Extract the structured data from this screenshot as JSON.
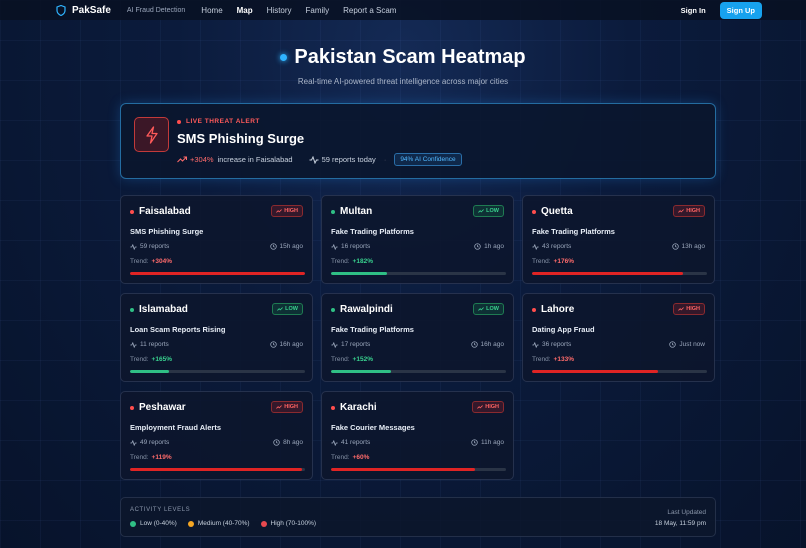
{
  "colors": {
    "high": "#e02424",
    "low": "#2fbf85",
    "medium": "#f5a623",
    "accent": "#17a2ee"
  },
  "nav": {
    "brand": "PakSafe",
    "tagline": "AI Fraud Detection",
    "links": [
      "Home",
      "Map",
      "History",
      "Family",
      "Report a Scam"
    ],
    "active": "Map",
    "sign_in": "Sign In",
    "sign_up": "Sign Up"
  },
  "hero": {
    "title": "Pakistan Scam Heatmap",
    "subtitle": "Real-time AI-powered threat intelligence across major cities"
  },
  "alert": {
    "tag": "LIVE THREAT ALERT",
    "title": "SMS Phishing Surge",
    "increase": "+304%",
    "increase_text": "increase in Faisalabad",
    "reports": "59 reports today",
    "confidence": "94% AI Confidence",
    "icon": "lightning-icon"
  },
  "cards": [
    {
      "city": "Faisalabad",
      "level": "HIGH",
      "type": "SMS Phishing Surge",
      "reports": "59 reports",
      "time": "15h ago",
      "trend_label": "Trend:",
      "trend": "+304%",
      "progress": 1.0
    },
    {
      "city": "Multan",
      "level": "LOW",
      "type": "Fake Trading Platforms",
      "reports": "16 reports",
      "time": "1h ago",
      "trend_label": "Trend:",
      "trend": "+182%",
      "progress": 0.32
    },
    {
      "city": "Quetta",
      "level": "HIGH",
      "type": "Fake Trading Platforms",
      "reports": "43 reports",
      "time": "13h ago",
      "trend_label": "Trend:",
      "trend": "+176%",
      "progress": 0.86
    },
    {
      "city": "Islamabad",
      "level": "LOW",
      "type": "Loan Scam Reports Rising",
      "reports": "11 reports",
      "time": "16h ago",
      "trend_label": "Trend:",
      "trend": "+165%",
      "progress": 0.22
    },
    {
      "city": "Rawalpindi",
      "level": "LOW",
      "type": "Fake Trading Platforms",
      "reports": "17 reports",
      "time": "16h ago",
      "trend_label": "Trend:",
      "trend": "+152%",
      "progress": 0.34
    },
    {
      "city": "Lahore",
      "level": "HIGH",
      "type": "Dating App Fraud",
      "reports": "36 reports",
      "time": "Just now",
      "trend_label": "Trend:",
      "trend": "+133%",
      "progress": 0.72
    },
    {
      "city": "Peshawar",
      "level": "HIGH",
      "type": "Employment Fraud Alerts",
      "reports": "49 reports",
      "time": "8h ago",
      "trend_label": "Trend:",
      "trend": "+119%",
      "progress": 0.98
    },
    {
      "city": "Karachi",
      "level": "HIGH",
      "type": "Fake Courier Messages",
      "reports": "41 reports",
      "time": "11h ago",
      "trend_label": "Trend:",
      "trend": "+60%",
      "progress": 0.82
    }
  ],
  "legend": {
    "title": "ACTIVITY LEVELS",
    "low": "Low (0-40%)",
    "medium": "Medium (40-70%)",
    "high": "High (70-100%)",
    "updated_label": "Last Updated",
    "updated_value": "18 May, 11:59 pm"
  }
}
